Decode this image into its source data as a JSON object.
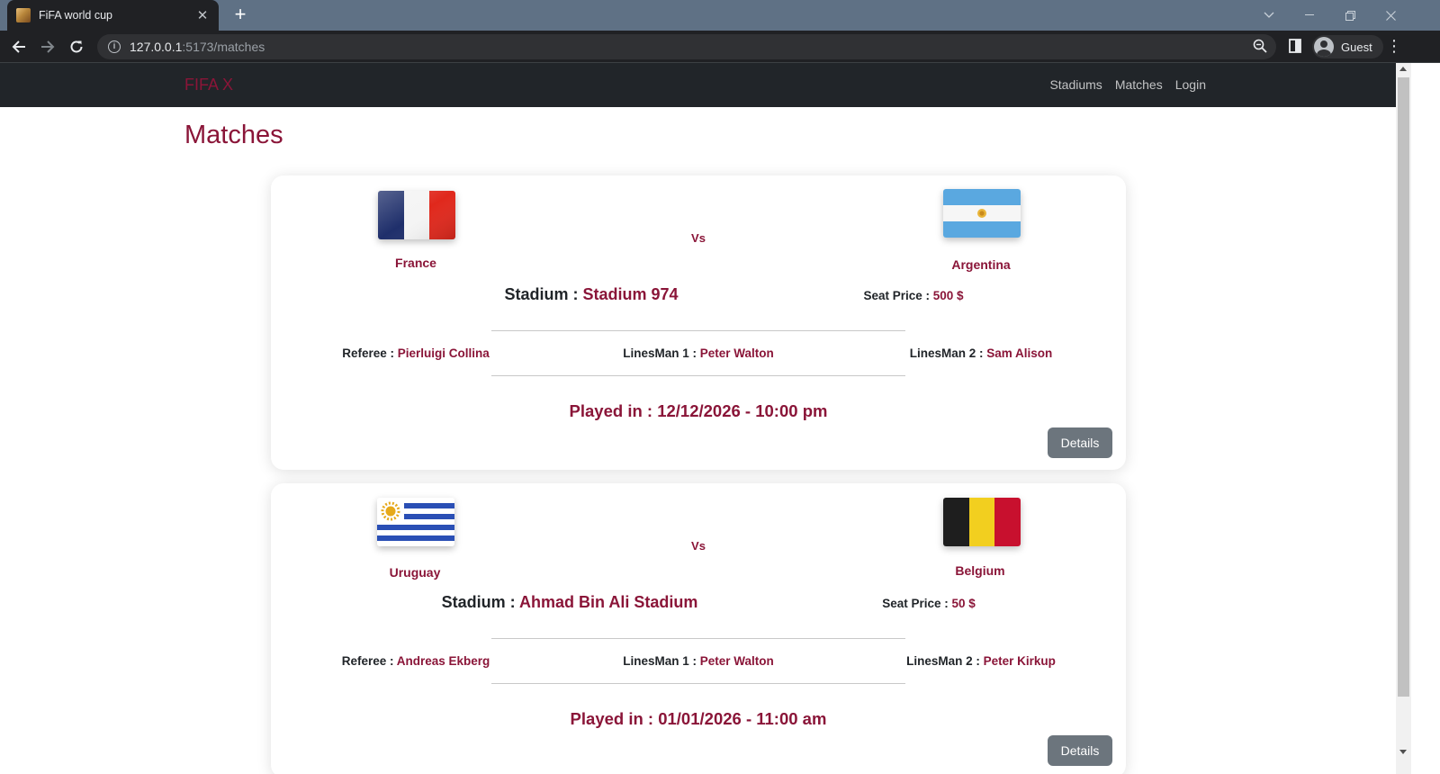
{
  "browser": {
    "tab_title": "FiFA world cup",
    "url_host": "127.0.0.1",
    "url_path": ":5173/matches",
    "profile_label": "Guest"
  },
  "nav": {
    "brand": "FIFA X",
    "links": [
      "Stadiums",
      "Matches",
      "Login"
    ]
  },
  "page": {
    "title": "Matches"
  },
  "labels": {
    "vs": "Vs",
    "stadium": "Stadium : ",
    "seat_price": "Seat Price : ",
    "referee": "Referee : ",
    "linesman1": "LinesMan 1 : ",
    "linesman2": "LinesMan 2 : ",
    "played_in": "Played in : ",
    "details": "Details"
  },
  "matches": [
    {
      "home": "France",
      "away": "Argentina",
      "stadium": "Stadium 974",
      "seat_price": "500 $",
      "referee": "Pierluigi Collina",
      "linesman1": "Peter Walton",
      "linesman2": "Sam Alison",
      "played": "12/12/2026 - 10:00 pm"
    },
    {
      "home": "Uruguay",
      "away": "Belgium",
      "stadium": "Ahmad Bin Ali Stadium",
      "seat_price": "50 $",
      "referee": "Andreas Ekberg",
      "linesman1": "Peter Walton",
      "linesman2": "Peter Kirkup",
      "played": "01/01/2026 - 11:00 am"
    }
  ],
  "colors": {
    "accent": "#8a1538",
    "navbar": "#212529",
    "button": "#6c757d"
  }
}
